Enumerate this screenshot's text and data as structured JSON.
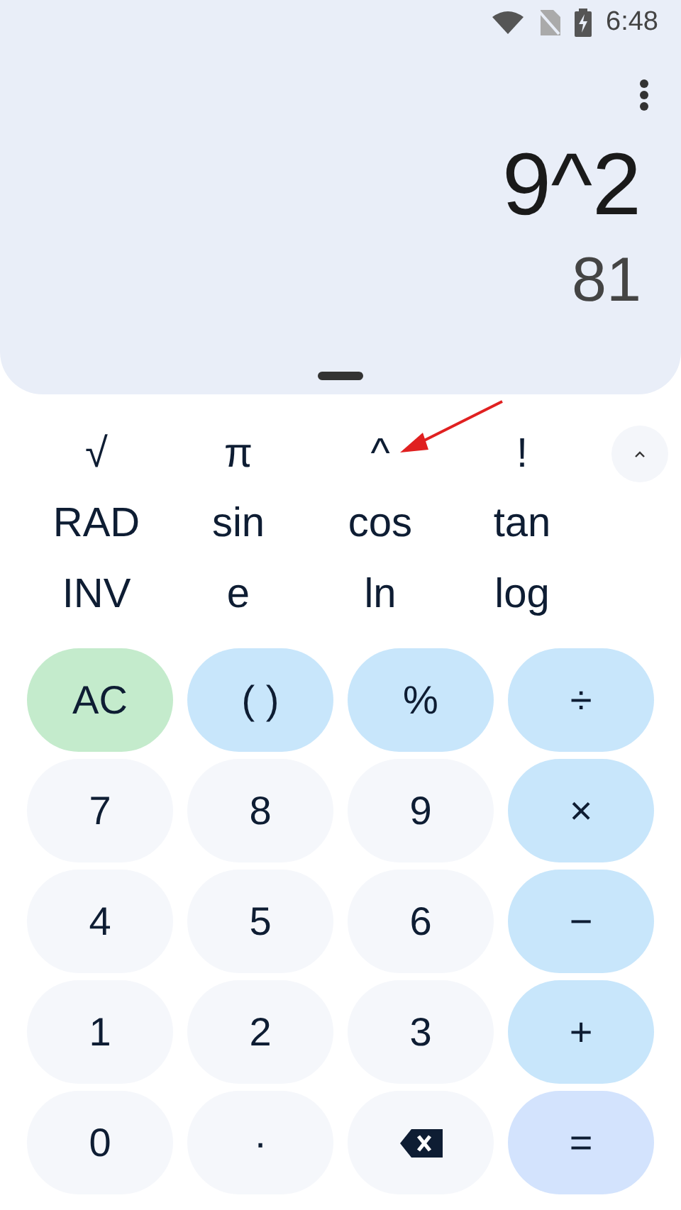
{
  "status_bar": {
    "time": "6:48"
  },
  "display": {
    "expression": "9^2",
    "result": "81"
  },
  "scientific": {
    "expanded": true,
    "keys": [
      {
        "label": "√"
      },
      {
        "label": "π"
      },
      {
        "label": "^"
      },
      {
        "label": "!"
      },
      {
        "label": "RAD"
      },
      {
        "label": "sin"
      },
      {
        "label": "cos"
      },
      {
        "label": "tan"
      },
      {
        "label": "INV"
      },
      {
        "label": "e"
      },
      {
        "label": "ln"
      },
      {
        "label": "log"
      }
    ]
  },
  "keypad": [
    {
      "kind": "clear",
      "label": "AC"
    },
    {
      "kind": "op",
      "label": "( )"
    },
    {
      "kind": "op",
      "label": "%"
    },
    {
      "kind": "op",
      "label": "÷"
    },
    {
      "kind": "digit",
      "label": "7"
    },
    {
      "kind": "digit",
      "label": "8"
    },
    {
      "kind": "digit",
      "label": "9"
    },
    {
      "kind": "op",
      "label": "×"
    },
    {
      "kind": "digit",
      "label": "4"
    },
    {
      "kind": "digit",
      "label": "5"
    },
    {
      "kind": "digit",
      "label": "6"
    },
    {
      "kind": "op",
      "label": "−"
    },
    {
      "kind": "digit",
      "label": "1"
    },
    {
      "kind": "digit",
      "label": "2"
    },
    {
      "kind": "digit",
      "label": "3"
    },
    {
      "kind": "op",
      "label": "+"
    },
    {
      "kind": "digit",
      "label": "0"
    },
    {
      "kind": "digit",
      "label": "·"
    },
    {
      "kind": "backspace"
    },
    {
      "kind": "equals",
      "label": "="
    }
  ]
}
